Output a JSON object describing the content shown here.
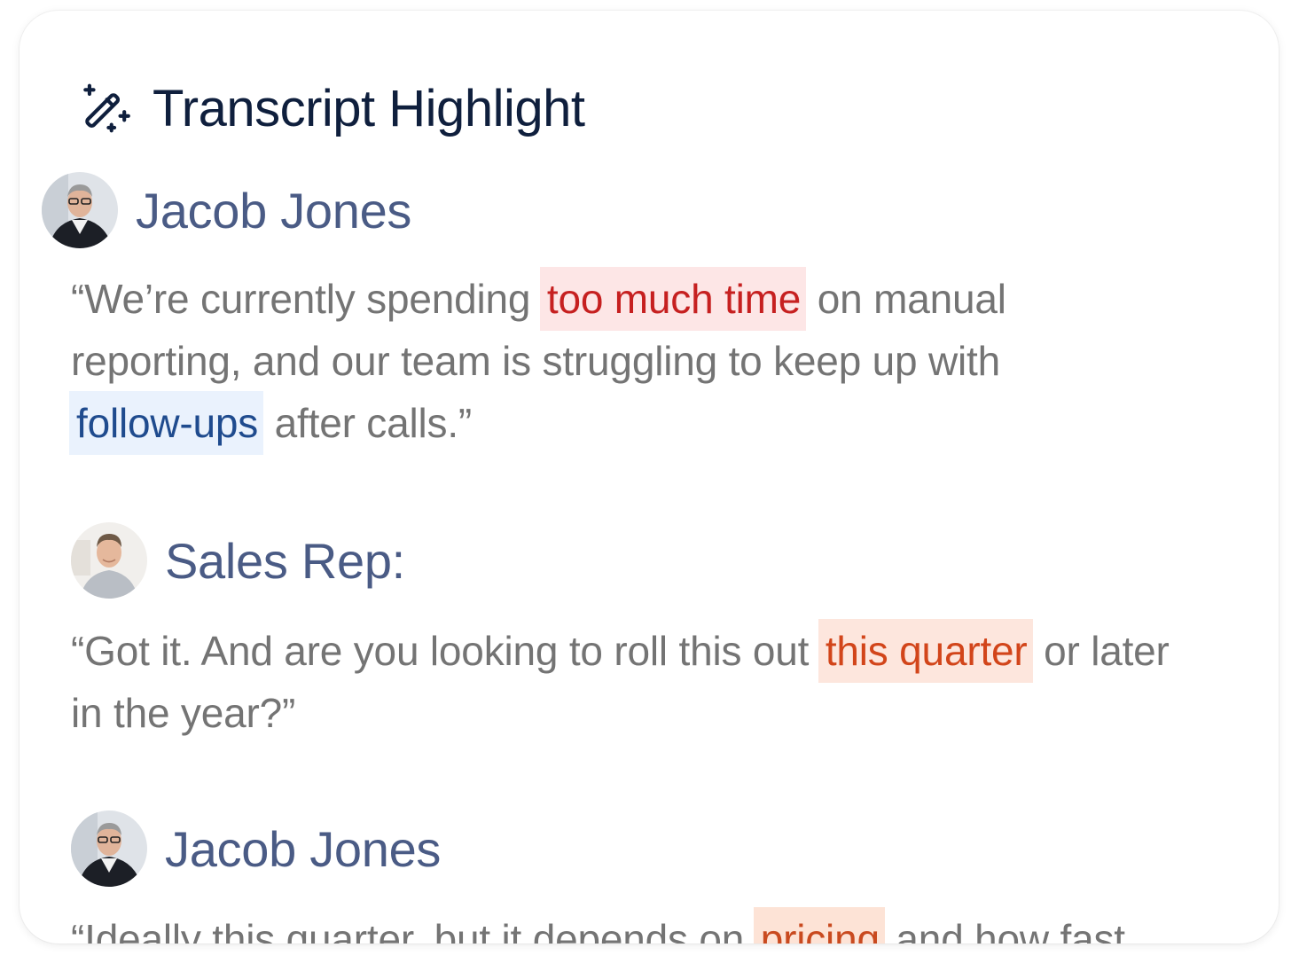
{
  "card": {
    "title": "Transcript Highlight",
    "title_icon": "magic-wand-icon"
  },
  "entries": [
    {
      "speaker": "Jacob Jones",
      "avatar": "avatar-jacob-jones",
      "quote_parts": [
        {
          "text": "“We’re currently spending "
        },
        {
          "text": "too much time",
          "highlight": "red"
        },
        {
          "text": " on manual reporting, and our team is struggling to keep up with "
        },
        {
          "text": "follow-ups",
          "highlight": "blue"
        },
        {
          "text": " after calls.”"
        }
      ]
    },
    {
      "speaker": "Sales Rep:",
      "avatar": "avatar-sales-rep",
      "quote_parts": [
        {
          "text": "“Got it. And are you looking to roll this out "
        },
        {
          "text": "this quarter",
          "highlight": "orange"
        },
        {
          "text": " or later in the year?”"
        }
      ]
    },
    {
      "speaker": "Jacob Jones",
      "avatar": "avatar-jacob-jones",
      "quote_parts": [
        {
          "text": "“Ideally this quarter, but it depends on "
        },
        {
          "text": "pricing",
          "highlight": "peach"
        },
        {
          "text": " and how fast"
        }
      ]
    }
  ],
  "colors": {
    "title": "#0f1f3d",
    "speaker": "#4a5b85",
    "quote": "#747474",
    "highlight_red_bg": "#fde6e6",
    "highlight_red_text": "#c62020",
    "highlight_blue_bg": "#eaf2fd",
    "highlight_blue_text": "#1f4b8e",
    "highlight_orange_bg": "#fde6dd",
    "highlight_orange_text": "#d2451a"
  }
}
